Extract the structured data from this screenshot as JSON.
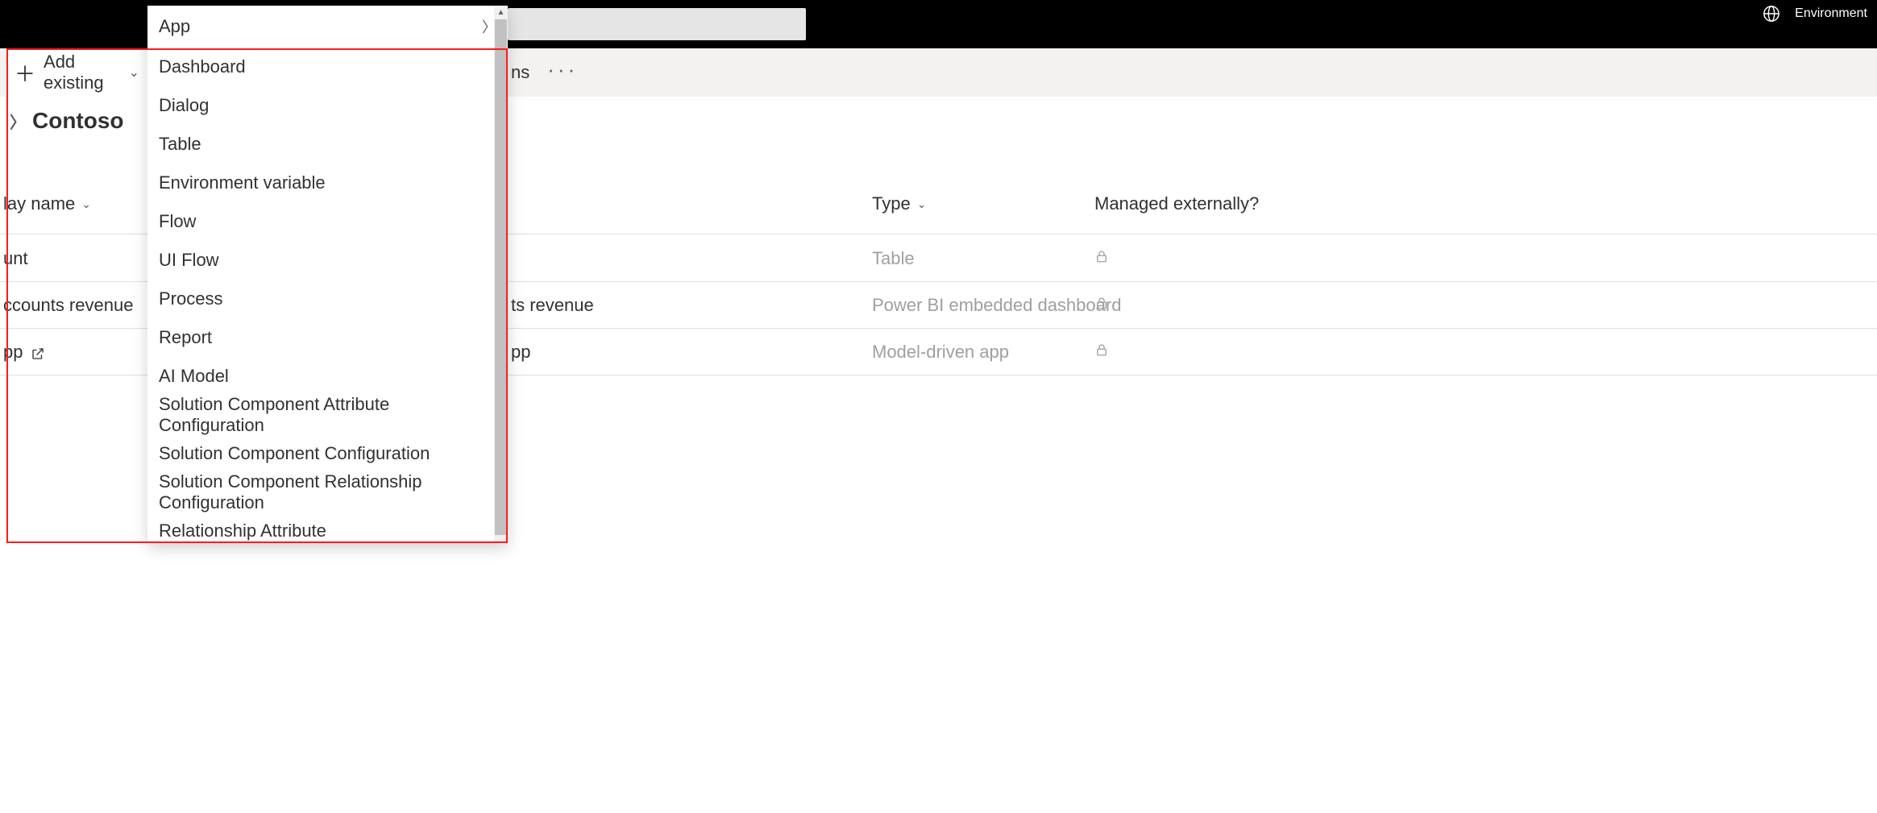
{
  "topbar": {
    "env_label": "Environment"
  },
  "commandbar": {
    "add_existing_label": "Add existing",
    "right_fragment": "ns"
  },
  "solution": {
    "name": "Contoso"
  },
  "columns": {
    "display_name": "lay name",
    "type": "Type",
    "managed_externally": "Managed externally?"
  },
  "rows": [
    {
      "left_fragment": "unt",
      "name2_fragment": "",
      "type": "Table"
    },
    {
      "left_fragment": "ccounts revenue",
      "name2_fragment": "ts revenue",
      "type": "Power BI embedded dashboard"
    },
    {
      "left_fragment": "pp",
      "name2_fragment": "pp",
      "type": "Model-driven app",
      "external_link": true
    }
  ],
  "menu": {
    "items": [
      {
        "label": "App",
        "has_submenu": true
      },
      {
        "label": "Dashboard"
      },
      {
        "label": "Dialog"
      },
      {
        "label": "Table"
      },
      {
        "label": "Environment variable"
      },
      {
        "label": "Flow"
      },
      {
        "label": "UI Flow"
      },
      {
        "label": "Process"
      },
      {
        "label": "Report"
      },
      {
        "label": "AI Model"
      },
      {
        "label": "Solution Component Attribute Configuration"
      },
      {
        "label": "Solution Component Configuration"
      },
      {
        "label": "Solution Component Relationship Configuration"
      },
      {
        "label": "Relationship Attribute"
      }
    ]
  }
}
